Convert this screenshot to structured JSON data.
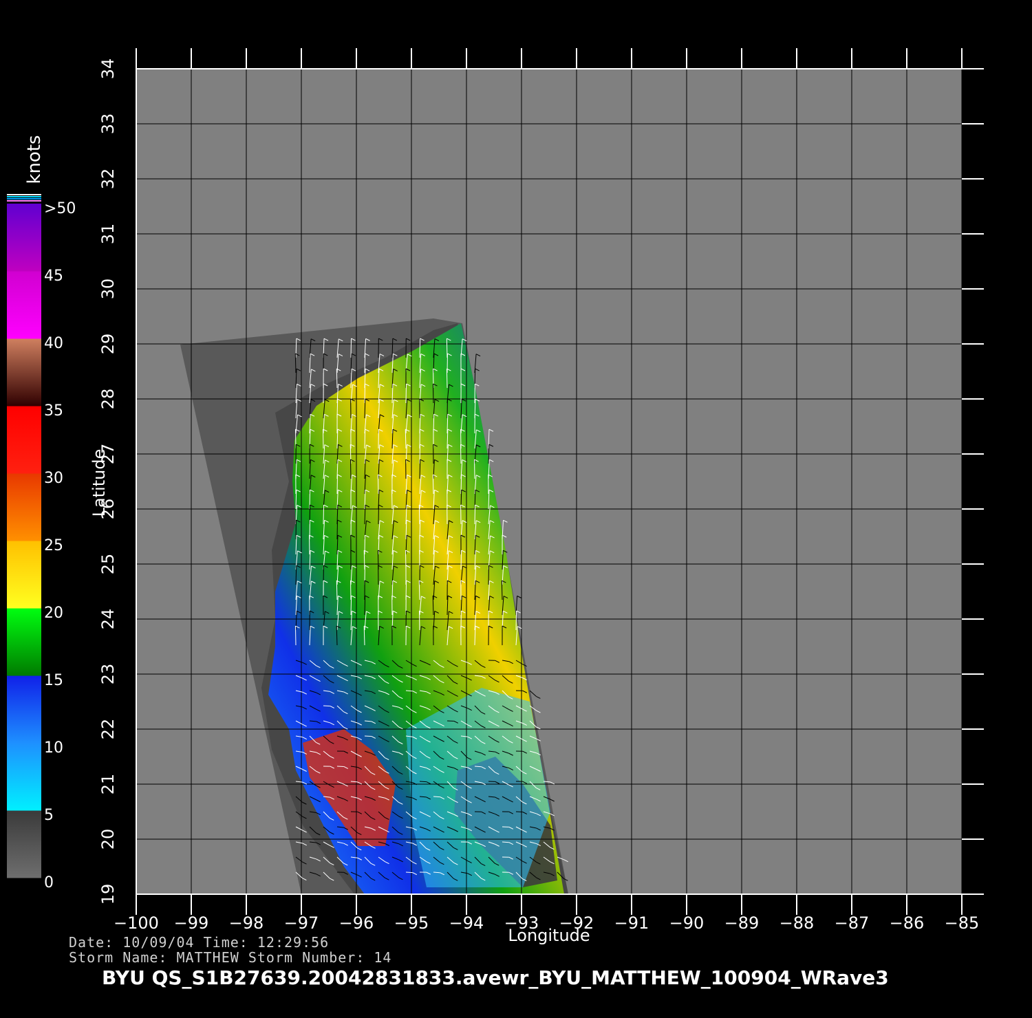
{
  "colorbar": {
    "unit": "knots",
    "labels": [
      ">50",
      "45",
      "40",
      "35",
      "30",
      "25",
      "20",
      "15",
      "10",
      "5",
      "0"
    ],
    "bands": [
      {
        "from": 0,
        "to": 5,
        "colors": [
          "#6e6e6e",
          "#3a3a3a"
        ]
      },
      {
        "from": 5,
        "to": 10,
        "colors": [
          "#00f0ff",
          "#1e90ff"
        ]
      },
      {
        "from": 10,
        "to": 15,
        "colors": [
          "#1e90ff",
          "#1020e8"
        ]
      },
      {
        "from": 15,
        "to": 20,
        "colors": [
          "#007a00",
          "#00ff10"
        ]
      },
      {
        "from": 20,
        "to": 25,
        "colors": [
          "#ffff20",
          "#ffc000"
        ]
      },
      {
        "from": 25,
        "to": 30,
        "colors": [
          "#ff9000",
          "#e83800"
        ]
      },
      {
        "from": 30,
        "to": 35,
        "colors": [
          "#ff2010",
          "#ff0000"
        ]
      },
      {
        "from": 35,
        "to": 40,
        "colors": [
          "#300000",
          "#d08060"
        ]
      },
      {
        "from": 40,
        "to": 45,
        "colors": [
          "#ff00ff",
          "#d000d0"
        ]
      },
      {
        "from": 45,
        "to": 50,
        "colors": [
          "#c000c0",
          "#6000d0"
        ]
      }
    ]
  },
  "axes": {
    "xlabel": "Longitude",
    "ylabel": "Latitude",
    "xlim": [
      -100,
      -85
    ],
    "ylim": [
      19,
      34
    ],
    "xticks": [
      "-100",
      "-99",
      "-98",
      "-97",
      "-96",
      "-95",
      "-94",
      "-93",
      "-92",
      "-91",
      "-90",
      "-89",
      "-88",
      "-87",
      "-86",
      "-85"
    ],
    "yticks": [
      "19",
      "20",
      "21",
      "22",
      "23",
      "24",
      "25",
      "26",
      "27",
      "28",
      "29",
      "30",
      "31",
      "32",
      "33",
      "34"
    ]
  },
  "colors": {
    "background": "#000000",
    "land": "#808080",
    "swath_outer": "#5a5a5a",
    "swath_inner": "#464646",
    "grid": "#000000",
    "frame": "#ffffff"
  },
  "info": {
    "line1": "Date: 10/09/04   Time: 12:29:56",
    "line2": "Storm Name: MATTHEW   Storm Number: 14",
    "filename": "BYU QS_S1B27639.20042831833.avewr_BYU_MATTHEW_100904_WRave3"
  }
}
